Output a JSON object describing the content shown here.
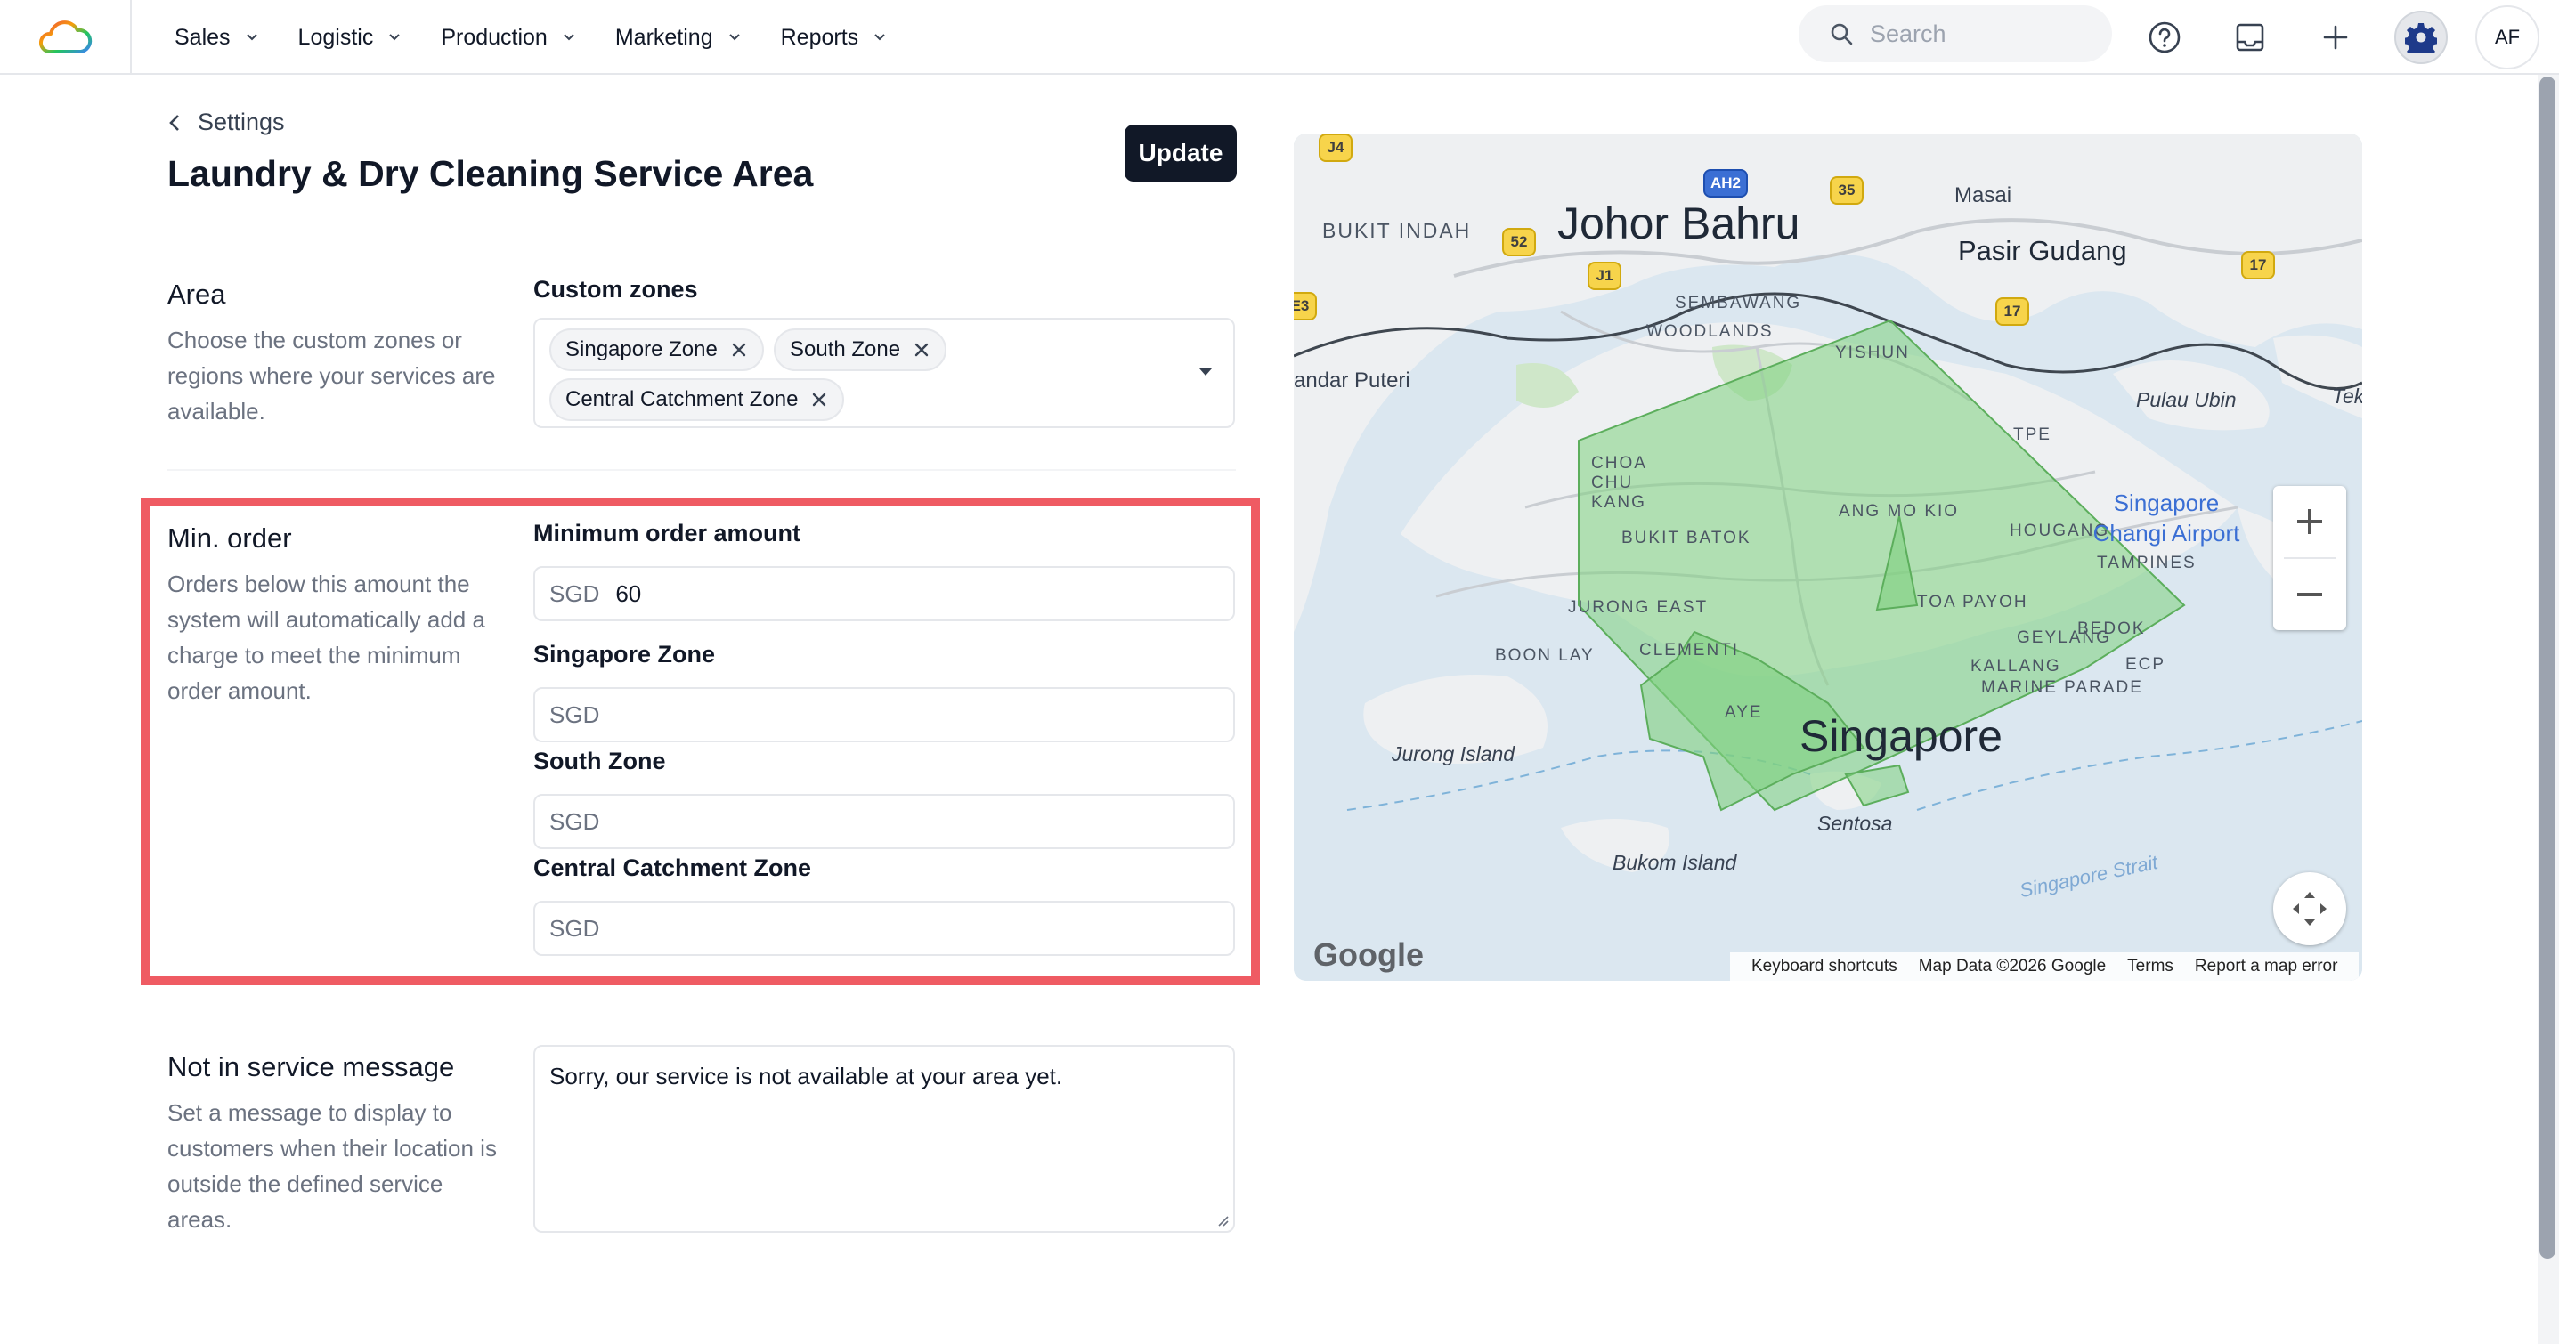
{
  "nav": {
    "items": [
      {
        "label": "Sales"
      },
      {
        "label": "Logistic"
      },
      {
        "label": "Production"
      },
      {
        "label": "Marketing"
      },
      {
        "label": "Reports"
      }
    ],
    "search_placeholder": "Search",
    "avatar_initials": "AF"
  },
  "header": {
    "back_label": "Settings",
    "title": "Laundry & Dry Cleaning Service Area",
    "update_label": "Update"
  },
  "area": {
    "title": "Area",
    "description": "Choose the custom zones or regions where your services are available.",
    "field_label": "Custom zones",
    "chips": [
      "Singapore Zone",
      "South Zone",
      "Central Catchment Zone"
    ]
  },
  "min_order": {
    "title": "Min. order",
    "description": "Orders below this amount the system will automatically add a charge to meet the minimum order amount.",
    "fields": [
      {
        "label": "Minimum order amount",
        "prefix": "SGD",
        "value": "60"
      },
      {
        "label": "Singapore Zone",
        "prefix": "SGD",
        "value": ""
      },
      {
        "label": "South Zone",
        "prefix": "SGD",
        "value": ""
      },
      {
        "label": "Central Catchment Zone",
        "prefix": "SGD",
        "value": ""
      }
    ]
  },
  "not_in_service": {
    "title": "Not in service message",
    "description": "Set a message to display to customers when their location is outside the defined service areas.",
    "message": "Sorry, our service is not available at your area yet."
  },
  "map": {
    "labels": {
      "johor_bahru": "Johor Bahru",
      "bukit_indah": "BUKIT INDAH",
      "masai": "Masai",
      "pasir_gudang": "Pasir Gudang",
      "sembawang": "SEMBAWANG",
      "woodlands": "WOODLANDS",
      "yishun": "YISHUN",
      "andar_puteri": "andar Puteri",
      "pulau_ubin": "Pulau Ubin",
      "tek": "Tek",
      "tpe": "TPE",
      "choa_chu_kang": "CHOA CHU KANG",
      "bukit_batok": "BUKIT BATOK",
      "ang_mo_kio": "ANG MO KIO",
      "hougang": "HOUGANG",
      "changi_airport": "Singapore Changi Airport",
      "tampines": "TAMPINES",
      "jurong_east": "JURONG EAST",
      "toa_payoh": "TOA PAYOH",
      "clementi": "CLEMENTI",
      "boon_lay": "BOON LAY",
      "geylang": "GEYLANG",
      "bedok": "BEDOK",
      "kallang": "KALLANG",
      "marine_parade": "MARINE PARADE",
      "ecp": "ECP",
      "ayer": "AYE",
      "jurong_island": "Jurong Island",
      "singapore": "Singapore",
      "sentosa": "Sentosa",
      "bukom_island": "Bukom Island",
      "singapore_strait": "Singapore Strait"
    },
    "shields": [
      "J4",
      "AH2",
      "35",
      "52",
      "J1",
      "17",
      "17",
      "E3"
    ],
    "google_logo": "Google",
    "attribution": [
      "Keyboard shortcuts",
      "Map Data ©2026 Google",
      "Terms",
      "Report a map error"
    ],
    "zone_color": "#7ed17e"
  },
  "colors": {
    "highlight_border": "#ef5b63",
    "primary_button": "#111827"
  }
}
